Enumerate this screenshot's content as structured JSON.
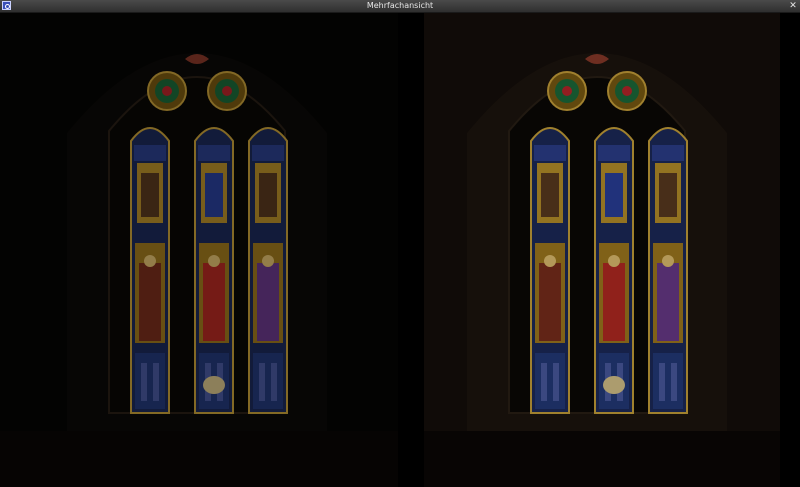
{
  "window": {
    "title": "Mehrfachansicht",
    "icon": "app-icon",
    "close_label": "✕"
  },
  "views": [
    {
      "name": "left-view",
      "variant": "darker"
    },
    {
      "name": "right-view",
      "variant": "warmer"
    }
  ]
}
